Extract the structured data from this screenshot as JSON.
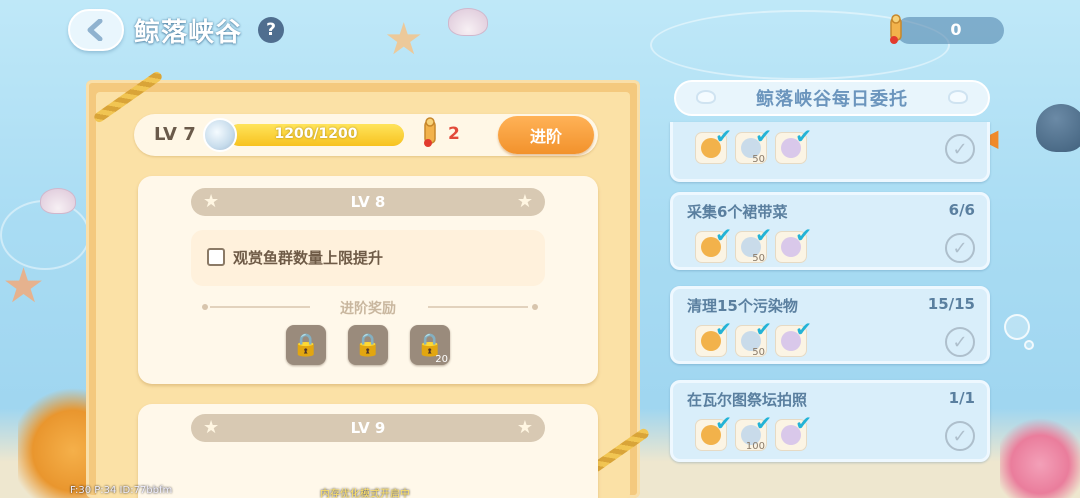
{
  "header": {
    "title": "鲸落峡谷",
    "help_label": "?",
    "currency_value": "0"
  },
  "level_panel": {
    "current_level": "LV 7",
    "progress_text": "1200/1200",
    "progress_fraction": 1.0,
    "cost_count": "2",
    "advance_label": "进阶"
  },
  "level_cards": [
    {
      "level": "LV 8",
      "effect": "观赏鱼群数量上限提升",
      "reward_label": "进阶奖励",
      "rewards": [
        {
          "icon": "lock-icon",
          "qty": ""
        },
        {
          "icon": "lock-icon",
          "qty": ""
        },
        {
          "icon": "lock-icon",
          "qty": "20"
        }
      ]
    },
    {
      "level": "LV 9"
    }
  ],
  "daily": {
    "title": "鲸落峡谷每日委托",
    "tasks": [
      {
        "name": "",
        "count": "",
        "rewards": [
          {
            "qty": ""
          },
          {
            "qty": "50"
          },
          {
            "qty": ""
          }
        ]
      },
      {
        "name": "采集6个裙带菜",
        "count": "6/6",
        "rewards": [
          {
            "qty": ""
          },
          {
            "qty": "50"
          },
          {
            "qty": ""
          }
        ]
      },
      {
        "name": "清理15个污染物",
        "count": "15/15",
        "rewards": [
          {
            "qty": ""
          },
          {
            "qty": "50"
          },
          {
            "qty": ""
          }
        ]
      },
      {
        "name": "在瓦尔图祭坛拍照",
        "count": "1/1",
        "rewards": [
          {
            "qty": ""
          },
          {
            "qty": "100"
          },
          {
            "qty": ""
          }
        ]
      }
    ]
  },
  "footer": {
    "perf": "F:30  P:34  ID:77bbfm",
    "notice": "内存优化模式开启中"
  },
  "colors": {
    "accent_orange": "#f2922c",
    "check_blue": "#24b3d6",
    "cost_red": "#e24a3a"
  }
}
